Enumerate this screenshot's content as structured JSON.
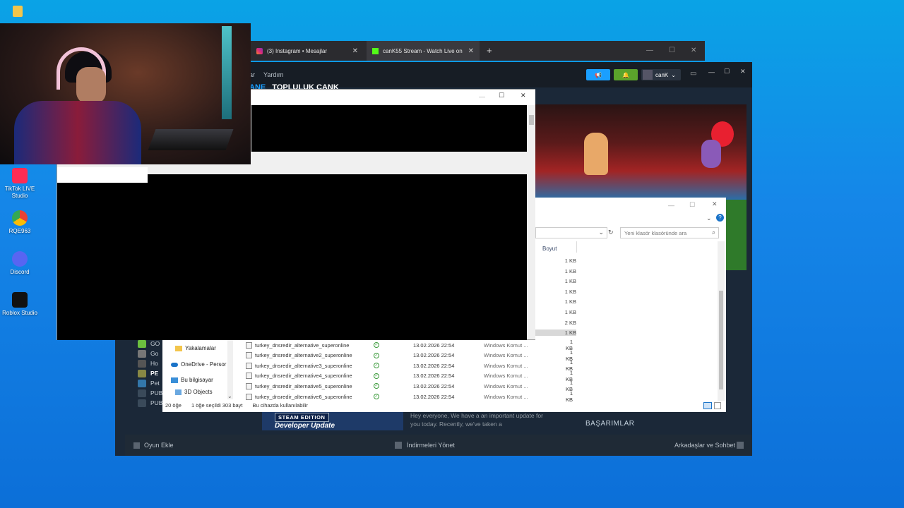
{
  "desktop": {
    "icons": [
      {
        "label": "TikTok LIVE Studio",
        "icon": "tiktok-icon",
        "color": "#fe2c55"
      },
      {
        "label": "RQE963",
        "icon": "chrome-icon",
        "color": "#e94235"
      },
      {
        "label": "Discord",
        "icon": "discord-icon",
        "color": "#5865f2"
      },
      {
        "label": "Roblox Studio",
        "icon": "roblox-icon",
        "color": "#111111"
      }
    ]
  },
  "browser": {
    "tabs": [
      {
        "label": "(3) Instagram • Mesajlar",
        "icon": "instagram-icon"
      },
      {
        "label": "canK55 Stream - Watch Live on",
        "icon": "kick-icon"
      }
    ],
    "new_tab": "+"
  },
  "steam": {
    "menu_help": "Yardım",
    "nav_partial": "TOPLULUK   CANK",
    "nav_left_partial": "ANE",
    "menu_left_partial": "ar",
    "user": "canK",
    "bottom": {
      "add_game": "Oyun Ekle",
      "downloads": "İndirmeleri Yönet",
      "friends": "Arkadaşlar ve Sohbet"
    },
    "achievements": "BAŞARIMLAR",
    "news_badge": "STEAM EDITION",
    "news_title": "Developer Update",
    "news_text": "Hey everyone, We have a an important update for you today. Recently, we've taken a",
    "library": [
      {
        "label": "GO",
        "color": "#6cbf3f"
      },
      {
        "label": "Go",
        "color": "#666666"
      },
      {
        "label": "Ho",
        "color": "#555555"
      },
      {
        "label": "PE",
        "color": "#444444"
      },
      {
        "label": "Pet",
        "color": "#37a"
      },
      {
        "label": "PUBG: BATTLEGROUNDS",
        "color": "#555555"
      },
      {
        "label": "PUBG: Experimental Server",
        "color": "#555555"
      }
    ]
  },
  "explorer": {
    "search_placeholder": "Yeni klasör klasöründe ara",
    "size_header": "Boyut",
    "sidebar": [
      {
        "label": "Yakalamalar",
        "icon": "folder-icon"
      },
      {
        "label": "OneDrive - Persor",
        "icon": "onedrive-icon"
      },
      {
        "label": "Bu bilgisayar",
        "icon": "pc-icon"
      },
      {
        "label": "3D Objects",
        "icon": "3d-icon"
      }
    ],
    "sizes_top": [
      "1 KB",
      "1 KB",
      "1 KB",
      "1 KB",
      "1 KB",
      "1 KB",
      "2 KB",
      "1 KB"
    ],
    "files": [
      {
        "name": "turkey_dnsredir_alternative_superonline",
        "date": "13.02.2026 22:54",
        "type": "Windows Komut ...",
        "size": "1 KB"
      },
      {
        "name": "turkey_dnsredir_alternative2_superonline",
        "date": "13.02.2026 22:54",
        "type": "Windows Komut ...",
        "size": "1 KB"
      },
      {
        "name": "turkey_dnsredir_alternative3_superonline",
        "date": "13.02.2026 22:54",
        "type": "Windows Komut ...",
        "size": "1 KB"
      },
      {
        "name": "turkey_dnsredir_alternative4_superonline",
        "date": "13.02.2026 22:54",
        "type": "Windows Komut ...",
        "size": "1 KB"
      },
      {
        "name": "turkey_dnsredir_alternative5_superonline",
        "date": "13.02.2026 22:54",
        "type": "Windows Komut ...",
        "size": "1 KB"
      },
      {
        "name": "turkey_dnsredir_alternative6_superonline",
        "date": "13.02.2026 22:54",
        "type": "Windows Komut ...",
        "size": "1 KB"
      }
    ],
    "status": {
      "count": "20 öğe",
      "selected": "1 öğe seçildi  303 bayt",
      "availability": "Bu cihazda kullanılabilir"
    }
  }
}
